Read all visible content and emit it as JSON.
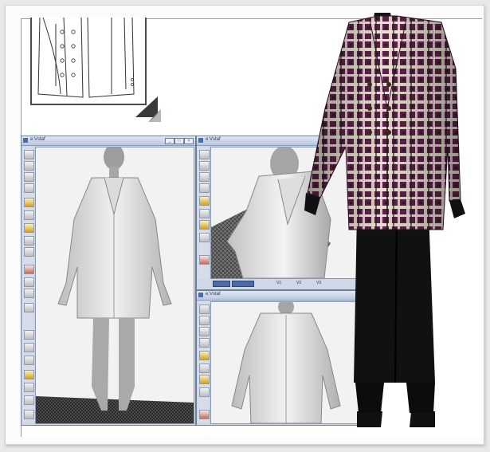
{
  "windows": {
    "front": {
      "title": "e:Vstaf"
    },
    "closeup": {
      "title": "e:Vstaf"
    },
    "back": {
      "title": "e:Vstaf"
    }
  },
  "statusbar": {
    "items": [
      "",
      "",
      "V1",
      "V2",
      "V3"
    ]
  },
  "icons": [
    "window-icon",
    "minimize-icon",
    "maximize-icon",
    "close-icon"
  ],
  "colors": {
    "window_blue": "#4a6da8",
    "plaid_purple": "#5a2346",
    "plaid_cream": "#e9e2d2",
    "accent_yellow": "#d1a12a"
  }
}
